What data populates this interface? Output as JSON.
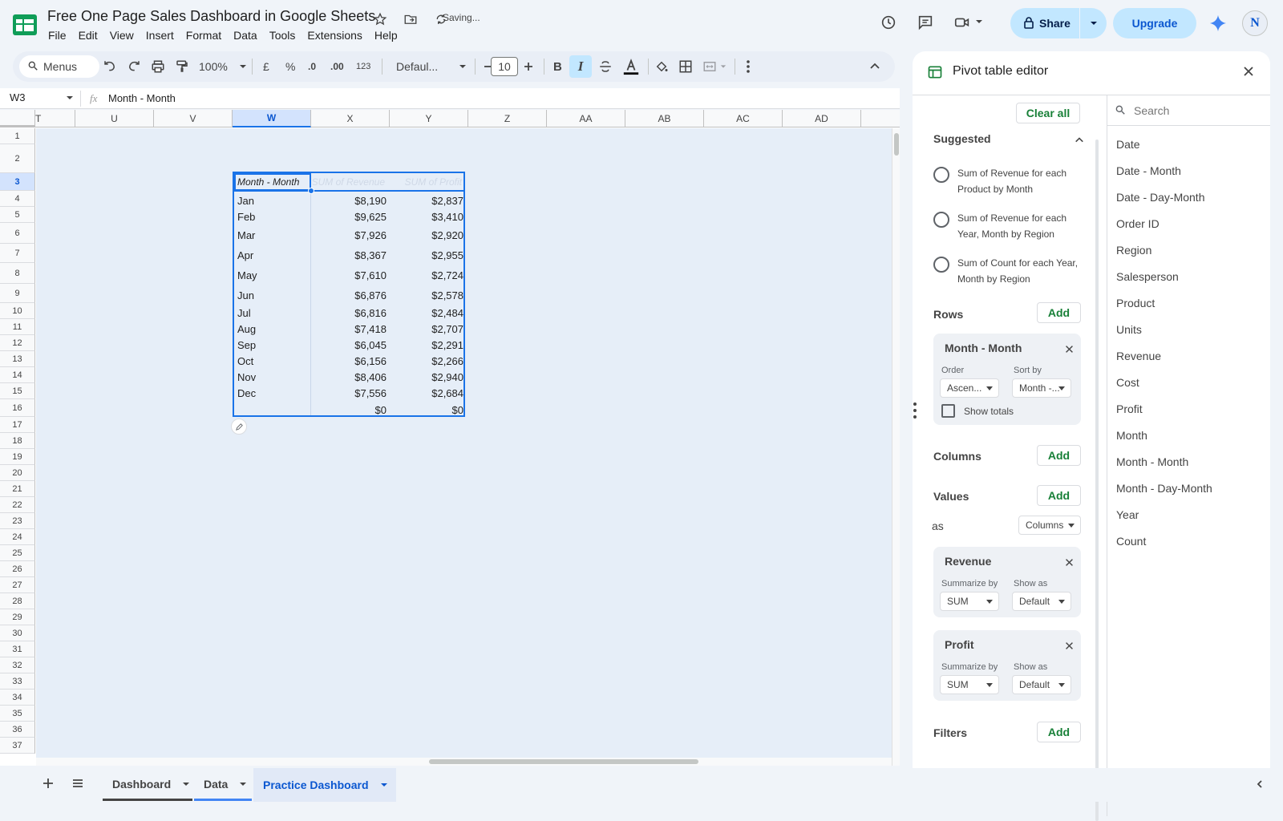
{
  "header": {
    "doc_title": "Free One Page Sales Dashboard in Google Sheets",
    "saving": "Saving...",
    "menus": [
      "File",
      "Edit",
      "View",
      "Insert",
      "Format",
      "Data",
      "Tools",
      "Extensions",
      "Help"
    ],
    "share_label": "Share",
    "upgrade_label": "Upgrade",
    "avatar_initial": "N"
  },
  "toolbar": {
    "search_menus": "Menus",
    "zoom": "100%",
    "currency": "£",
    "percent": "%",
    "dec_dec": ".0",
    "inc_dec": ".00",
    "format_num": "123",
    "font": "Defaul...",
    "font_size": "10"
  },
  "formula": {
    "cell_ref": "W3",
    "fx": "fx",
    "value": "Month - Month"
  },
  "grid": {
    "columns": [
      "T",
      "U",
      "V",
      "W",
      "X",
      "Y",
      "Z",
      "AA",
      "AB",
      "AC",
      "AD"
    ],
    "rows": [
      "1",
      "2",
      "3",
      "4",
      "5",
      "6",
      "7",
      "8",
      "9",
      "10",
      "11",
      "12",
      "13",
      "14",
      "15",
      "16",
      "17",
      "18",
      "19",
      "20",
      "21",
      "22",
      "23",
      "24",
      "25",
      "26",
      "27",
      "28",
      "29",
      "30",
      "31",
      "32",
      "33",
      "34",
      "35",
      "36",
      "37"
    ]
  },
  "pivot": {
    "headers": [
      "Month - Month",
      "SUM of Revenue",
      "SUM of Profit"
    ],
    "rows": [
      [
        "Jan",
        "$8,190",
        "$2,837"
      ],
      [
        "Feb",
        "$9,625",
        "$3,410"
      ],
      [
        "Mar",
        "$7,926",
        "$2,920"
      ],
      [
        "Apr",
        "$8,367",
        "$2,955"
      ],
      [
        "May",
        "$7,610",
        "$2,724"
      ],
      [
        "Jun",
        "$6,876",
        "$2,578"
      ],
      [
        "Jul",
        "$6,816",
        "$2,484"
      ],
      [
        "Aug",
        "$7,418",
        "$2,707"
      ],
      [
        "Sep",
        "$6,045",
        "$2,291"
      ],
      [
        "Oct",
        "$6,156",
        "$2,266"
      ],
      [
        "Nov",
        "$8,406",
        "$2,940"
      ],
      [
        "Dec",
        "$7,556",
        "$2,684"
      ],
      [
        "",
        "$0",
        "$0"
      ]
    ]
  },
  "panel": {
    "title": "Pivot table editor",
    "clear_all": "Clear all",
    "suggested": "Suggested",
    "suggestions": [
      "Sum of Revenue for each Product by Month",
      "Sum of Revenue for each Year, Month by Region",
      "Sum of Count for each Year, Month by Region"
    ],
    "rows_label": "Rows",
    "add": "Add",
    "row_field": {
      "name": "Month - Month",
      "order_label": "Order",
      "order_value": "Ascen...",
      "sortby_label": "Sort by",
      "sortby_value": "Month -...",
      "show_totals": "Show totals"
    },
    "columns_label": "Columns",
    "values_label": "Values",
    "as_label": "as",
    "as_value": "Columns",
    "values": [
      {
        "name": "Revenue",
        "summ_label": "Summarize by",
        "summ": "SUM",
        "show_label": "Show as",
        "show": "Default"
      },
      {
        "name": "Profit",
        "summ_label": "Summarize by",
        "summ": "SUM",
        "show_label": "Show as",
        "show": "Default"
      }
    ],
    "filters_label": "Filters",
    "search_placeholder": "Search",
    "fields": [
      "Date",
      "Date - Month",
      "Date - Day-Month",
      "Order ID",
      "Region",
      "Salesperson",
      "Product",
      "Units",
      "Revenue",
      "Cost",
      "Profit",
      "Month",
      "Month - Month",
      "Month - Day-Month",
      "Year",
      "Count"
    ]
  },
  "sheets": {
    "tabs": [
      "Dashboard",
      "Data",
      "Practice Dashboard"
    ]
  },
  "colors": {
    "accent": "#0b57d0",
    "green": "#188038",
    "selection": "#e6eef8"
  }
}
